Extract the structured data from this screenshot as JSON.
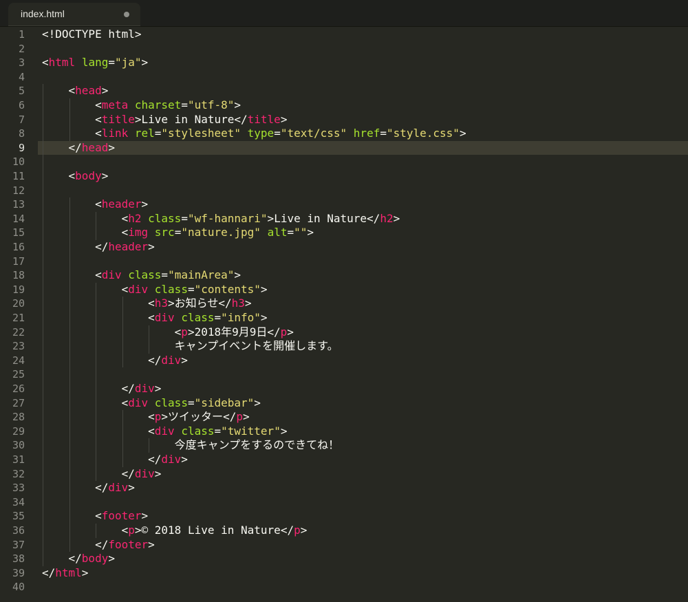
{
  "tab": {
    "filename": "index.html",
    "unsaved": true
  },
  "editor": {
    "current_line": 9,
    "lines": [
      [
        [
          "p",
          "<!DOCTYPE html>"
        ]
      ],
      [],
      [
        [
          "p",
          "<"
        ],
        [
          "t",
          "html"
        ],
        [
          "p",
          " "
        ],
        [
          "a",
          "lang"
        ],
        [
          "p",
          "="
        ],
        [
          "s",
          "\"ja\""
        ],
        [
          "p",
          ">"
        ]
      ],
      [],
      [
        [
          "i",
          "    "
        ],
        [
          "p",
          "<"
        ],
        [
          "t",
          "head"
        ],
        [
          "p",
          ">"
        ]
      ],
      [
        [
          "i",
          "        "
        ],
        [
          "p",
          "<"
        ],
        [
          "t",
          "meta"
        ],
        [
          "p",
          " "
        ],
        [
          "a",
          "charset"
        ],
        [
          "p",
          "="
        ],
        [
          "s",
          "\"utf-8\""
        ],
        [
          "p",
          ">"
        ]
      ],
      [
        [
          "i",
          "        "
        ],
        [
          "p",
          "<"
        ],
        [
          "t",
          "title"
        ],
        [
          "p",
          ">"
        ],
        [
          "x",
          "Live in Nature"
        ],
        [
          "p",
          "</"
        ],
        [
          "t",
          "title"
        ],
        [
          "p",
          ">"
        ]
      ],
      [
        [
          "i",
          "        "
        ],
        [
          "p",
          "<"
        ],
        [
          "t",
          "link"
        ],
        [
          "p",
          " "
        ],
        [
          "a",
          "rel"
        ],
        [
          "p",
          "="
        ],
        [
          "s",
          "\"stylesheet\""
        ],
        [
          "p",
          " "
        ],
        [
          "a",
          "type"
        ],
        [
          "p",
          "="
        ],
        [
          "s",
          "\"text/css\""
        ],
        [
          "p",
          " "
        ],
        [
          "a",
          "href"
        ],
        [
          "p",
          "="
        ],
        [
          "s",
          "\"style.css\""
        ],
        [
          "p",
          ">"
        ]
      ],
      [
        [
          "i",
          "    "
        ],
        [
          "p",
          "</"
        ],
        [
          "t",
          "head"
        ],
        [
          "p",
          ">"
        ]
      ],
      [],
      [
        [
          "i",
          "    "
        ],
        [
          "p",
          "<"
        ],
        [
          "t",
          "body"
        ],
        [
          "p",
          ">"
        ]
      ],
      [],
      [
        [
          "i",
          "        "
        ],
        [
          "p",
          "<"
        ],
        [
          "t",
          "header"
        ],
        [
          "p",
          ">"
        ]
      ],
      [
        [
          "i",
          "            "
        ],
        [
          "p",
          "<"
        ],
        [
          "t",
          "h2"
        ],
        [
          "p",
          " "
        ],
        [
          "a",
          "class"
        ],
        [
          "p",
          "="
        ],
        [
          "s",
          "\"wf-hannari\""
        ],
        [
          "p",
          ">"
        ],
        [
          "x",
          "Live in Nature"
        ],
        [
          "p",
          "</"
        ],
        [
          "t",
          "h2"
        ],
        [
          "p",
          ">"
        ]
      ],
      [
        [
          "i",
          "            "
        ],
        [
          "p",
          "<"
        ],
        [
          "t",
          "img"
        ],
        [
          "p",
          " "
        ],
        [
          "a",
          "src"
        ],
        [
          "p",
          "="
        ],
        [
          "s",
          "\"nature.jpg\""
        ],
        [
          "p",
          " "
        ],
        [
          "a",
          "alt"
        ],
        [
          "p",
          "="
        ],
        [
          "s",
          "\"\""
        ],
        [
          "p",
          ">"
        ]
      ],
      [
        [
          "i",
          "        "
        ],
        [
          "p",
          "</"
        ],
        [
          "t",
          "header"
        ],
        [
          "p",
          ">"
        ]
      ],
      [],
      [
        [
          "i",
          "        "
        ],
        [
          "p",
          "<"
        ],
        [
          "t",
          "div"
        ],
        [
          "p",
          " "
        ],
        [
          "a",
          "class"
        ],
        [
          "p",
          "="
        ],
        [
          "s",
          "\"mainArea\""
        ],
        [
          "p",
          ">"
        ]
      ],
      [
        [
          "i",
          "            "
        ],
        [
          "p",
          "<"
        ],
        [
          "t",
          "div"
        ],
        [
          "p",
          " "
        ],
        [
          "a",
          "class"
        ],
        [
          "p",
          "="
        ],
        [
          "s",
          "\"contents\""
        ],
        [
          "p",
          ">"
        ]
      ],
      [
        [
          "i",
          "                "
        ],
        [
          "p",
          "<"
        ],
        [
          "t",
          "h3"
        ],
        [
          "p",
          ">"
        ],
        [
          "x",
          "お知らせ"
        ],
        [
          "p",
          "</"
        ],
        [
          "t",
          "h3"
        ],
        [
          "p",
          ">"
        ]
      ],
      [
        [
          "i",
          "                "
        ],
        [
          "p",
          "<"
        ],
        [
          "t",
          "div"
        ],
        [
          "p",
          " "
        ],
        [
          "a",
          "class"
        ],
        [
          "p",
          "="
        ],
        [
          "s",
          "\"info\""
        ],
        [
          "p",
          ">"
        ]
      ],
      [
        [
          "i",
          "                    "
        ],
        [
          "p",
          "<"
        ],
        [
          "t",
          "p"
        ],
        [
          "p",
          ">"
        ],
        [
          "x",
          "2018年9月9日"
        ],
        [
          "p",
          "</"
        ],
        [
          "t",
          "p"
        ],
        [
          "p",
          ">"
        ]
      ],
      [
        [
          "i",
          "                    "
        ],
        [
          "x",
          "キャンプイベントを開催します。"
        ]
      ],
      [
        [
          "i",
          "                "
        ],
        [
          "p",
          "</"
        ],
        [
          "t",
          "div"
        ],
        [
          "p",
          ">"
        ]
      ],
      [],
      [
        [
          "i",
          "            "
        ],
        [
          "p",
          "</"
        ],
        [
          "t",
          "div"
        ],
        [
          "p",
          ">"
        ]
      ],
      [
        [
          "i",
          "            "
        ],
        [
          "p",
          "<"
        ],
        [
          "t",
          "div"
        ],
        [
          "p",
          " "
        ],
        [
          "a",
          "class"
        ],
        [
          "p",
          "="
        ],
        [
          "s",
          "\"sidebar\""
        ],
        [
          "p",
          ">"
        ]
      ],
      [
        [
          "i",
          "                "
        ],
        [
          "p",
          "<"
        ],
        [
          "t",
          "p"
        ],
        [
          "p",
          ">"
        ],
        [
          "x",
          "ツイッター"
        ],
        [
          "p",
          "</"
        ],
        [
          "t",
          "p"
        ],
        [
          "p",
          ">"
        ]
      ],
      [
        [
          "i",
          "                "
        ],
        [
          "p",
          "<"
        ],
        [
          "t",
          "div"
        ],
        [
          "p",
          " "
        ],
        [
          "a",
          "class"
        ],
        [
          "p",
          "="
        ],
        [
          "s",
          "\"twitter\""
        ],
        [
          "p",
          ">"
        ]
      ],
      [
        [
          "i",
          "                    "
        ],
        [
          "x",
          "今度キャンプをするのできてね！"
        ]
      ],
      [
        [
          "i",
          "                "
        ],
        [
          "p",
          "</"
        ],
        [
          "t",
          "div"
        ],
        [
          "p",
          ">"
        ]
      ],
      [
        [
          "i",
          "            "
        ],
        [
          "p",
          "</"
        ],
        [
          "t",
          "div"
        ],
        [
          "p",
          ">"
        ]
      ],
      [
        [
          "i",
          "        "
        ],
        [
          "p",
          "</"
        ],
        [
          "t",
          "div"
        ],
        [
          "p",
          ">"
        ]
      ],
      [],
      [
        [
          "i",
          "        "
        ],
        [
          "p",
          "<"
        ],
        [
          "t",
          "footer"
        ],
        [
          "p",
          ">"
        ]
      ],
      [
        [
          "i",
          "            "
        ],
        [
          "p",
          "<"
        ],
        [
          "t",
          "p"
        ],
        [
          "p",
          ">"
        ],
        [
          "x",
          "© 2018 Live in Nature"
        ],
        [
          "p",
          "</"
        ],
        [
          "t",
          "p"
        ],
        [
          "p",
          ">"
        ]
      ],
      [
        [
          "i",
          "        "
        ],
        [
          "p",
          "</"
        ],
        [
          "t",
          "footer"
        ],
        [
          "p",
          ">"
        ]
      ],
      [
        [
          "i",
          "    "
        ],
        [
          "p",
          "</"
        ],
        [
          "t",
          "body"
        ],
        [
          "p",
          ">"
        ]
      ],
      [
        [
          "p",
          "</"
        ],
        [
          "t",
          "html"
        ],
        [
          "p",
          ">"
        ]
      ],
      []
    ]
  },
  "colors": {
    "background": "#272822",
    "tag": "#F92672",
    "attribute": "#A6E22E",
    "string": "#E6DB74",
    "text": "#F8F8F2",
    "gutter": "#90908a"
  }
}
